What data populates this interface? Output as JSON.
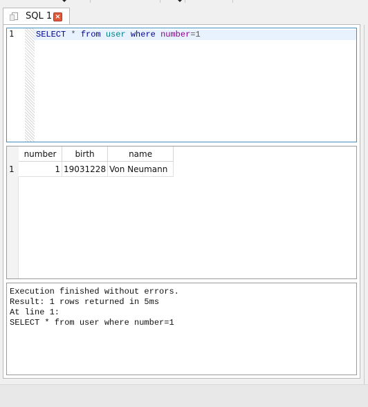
{
  "tab": {
    "label": "SQL 1",
    "close_glyph": "×",
    "doc_icon": "document-icon",
    "close_icon": "close-icon"
  },
  "editor": {
    "line_number": "1",
    "tokens": {
      "t1": "SELECT",
      "t2": " * ",
      "t3": "from",
      "t4": " ",
      "t5": "user",
      "t6": " ",
      "t7": "where",
      "t8": " ",
      "t9": "number",
      "t10": "=1"
    }
  },
  "results": {
    "columns": [
      "number",
      "birth",
      "name"
    ],
    "rows": [
      {
        "index": "1",
        "number": "1",
        "birth": "19031228",
        "name": "Von Neumann"
      }
    ]
  },
  "messages": {
    "line1": "Execution finished without errors.",
    "line2": "Result: 1 rows returned in 5ms",
    "line3": "At line 1:",
    "line4": "SELECT * from user where number=1"
  },
  "colors": {
    "editor_border": "#3c8fbf",
    "current_line": "#e8f2fe",
    "keyword": "#00008b",
    "identifier": "#008080",
    "number_ident": "#8b008b",
    "close_button": "#e05a3a"
  }
}
